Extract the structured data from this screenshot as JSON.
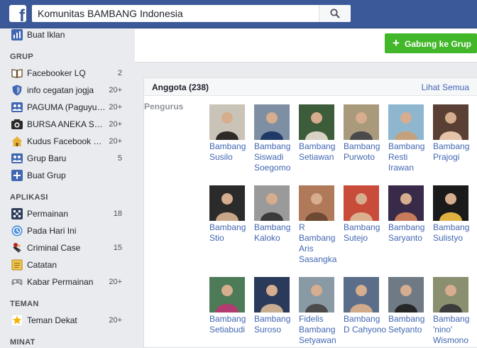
{
  "search": {
    "query": "Komunitas BAMBANG Indonesia"
  },
  "sidebar": {
    "top_item": {
      "label": "Buat Iklan",
      "icon": "bar-chart-icon"
    },
    "groups_heading": "GRUP",
    "groups": [
      {
        "label": "Facebooker LQ",
        "count": "2",
        "icon": "book-icon"
      },
      {
        "label": "info cegatan jogja",
        "count": "20+",
        "icon": "shield-icon"
      },
      {
        "label": "PAGUMA (Paguyuban...",
        "count": "20+",
        "icon": "group-icon"
      },
      {
        "label": "BURSA ANEKA SEPEDA",
        "count": "20+",
        "icon": "camera-icon"
      },
      {
        "label": "Kudus Facebook Community",
        "count": "20+",
        "icon": "house-icon"
      },
      {
        "label": "Grup Baru",
        "count": "5",
        "icon": "group-icon"
      },
      {
        "label": "Buat Grup",
        "count": "",
        "icon": "plus-icon"
      }
    ],
    "apps_heading": "APLIKASI",
    "apps": [
      {
        "label": "Permainan",
        "count": "18",
        "icon": "games-icon"
      },
      {
        "label": "Pada Hari Ini",
        "count": "",
        "icon": "history-icon"
      },
      {
        "label": "Criminal Case",
        "count": "15",
        "icon": "criminal-case-icon"
      },
      {
        "label": "Catatan",
        "count": "",
        "icon": "notes-icon"
      },
      {
        "label": "Kabar Permainan",
        "count": "20+",
        "icon": "gamepad-icon"
      }
    ],
    "friends_heading": "TEMAN",
    "friends": [
      {
        "label": "Teman Dekat",
        "count": "20+",
        "icon": "star-icon"
      }
    ],
    "interests_heading": "MINAT"
  },
  "main": {
    "join_button": "Gabung ke Grup",
    "members_title": "Anggota (238)",
    "see_all": "Lihat Semua",
    "role_label": "Pengurus",
    "members": [
      {
        "name": "Bambang Susilo"
      },
      {
        "name": "Bambang Siswadi Soegomo"
      },
      {
        "name": "Bambang Setiawan"
      },
      {
        "name": "Bambang Purwoto"
      },
      {
        "name": "Bambang Resti Irawan"
      },
      {
        "name": "Bambang Prajogi"
      },
      {
        "name": "Bambang Stio"
      },
      {
        "name": "Bambang Kaloko"
      },
      {
        "name": "R Bambang Aris Sasangka"
      },
      {
        "name": "Bambang Sutejo"
      },
      {
        "name": "Bambang Saryanto"
      },
      {
        "name": "Bambang Sulistyo"
      },
      {
        "name": "Bambang Setiabudi"
      },
      {
        "name": "Bambang Suroso"
      },
      {
        "name": "Fidelis Bambang Setyawan"
      },
      {
        "name": "Bambang D Cahyono"
      },
      {
        "name": "Bambang Setyanto"
      },
      {
        "name": "Bambang 'nino' Wismono"
      }
    ]
  },
  "colors": {
    "brand": "#3b5998",
    "link": "#4267b2",
    "join": "#42b72a"
  }
}
